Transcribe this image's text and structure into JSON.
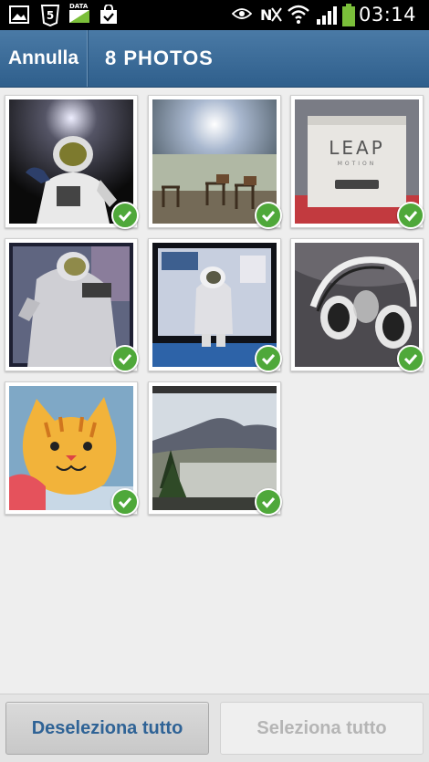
{
  "status_bar": {
    "time": "03:14",
    "left_icons": [
      "gallery-icon",
      "html5-icon",
      "data-icon",
      "shopping-bag-icon"
    ],
    "right_icons": [
      "eye-icon",
      "nfc-icon",
      "wifi-icon",
      "signal-icon",
      "battery-icon"
    ],
    "data_label": "DATA"
  },
  "action_bar": {
    "cancel_label": "Annulla",
    "title": "8 PHOTOS"
  },
  "photos": [
    {
      "subject": "astronaut figure",
      "selected": true
    },
    {
      "subject": "empty room with chairs",
      "selected": true
    },
    {
      "subject": "LEAP Motion box",
      "selected": true,
      "text": "LEAP",
      "subtext": "MOTION"
    },
    {
      "subject": "astronaut figure close-up",
      "selected": true
    },
    {
      "subject": "astronaut on monitor",
      "selected": true
    },
    {
      "subject": "headphones",
      "selected": true
    },
    {
      "subject": "cat mug",
      "selected": true
    },
    {
      "subject": "mountain landscape",
      "selected": true
    }
  ],
  "bottom_bar": {
    "deselect_label": "Deseleziona tutto",
    "select_label": "Seleziona tutto"
  },
  "colors": {
    "action_bar": "#3a6b98",
    "check": "#4fa83a",
    "deselect_text": "#2f6396",
    "select_text_disabled": "#b5b5b5"
  }
}
